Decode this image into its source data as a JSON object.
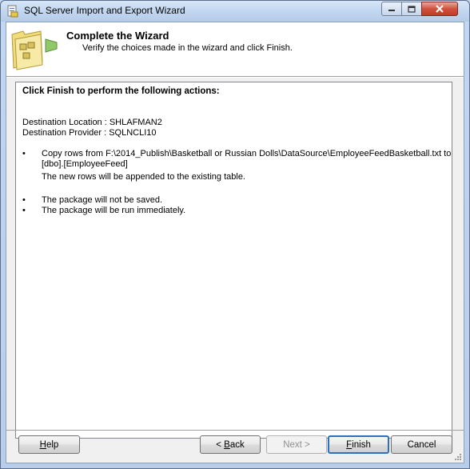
{
  "window": {
    "title": "SQL Server Import and Export Wizard"
  },
  "header": {
    "title": "Complete the Wizard",
    "subtitle": "Verify the choices made in the wizard and click Finish."
  },
  "content": {
    "heading": "Click Finish to perform the following actions:",
    "destination_location": "Destination Location : SHLAFMAN2",
    "destination_provider": "Destination Provider : SQLNCLI10",
    "actions": [
      {
        "line1": "Copy rows from F:\\2014_Publish\\Basketball or Russian Dolls\\DataSource\\EmployeeFeedBasketball.txt to",
        "line2": "[dbo].[EmployeeFeed]",
        "note": "The new rows will be appended to the existing table."
      },
      {
        "line1": "The package will not be saved."
      },
      {
        "line1": "The package will be run immediately."
      }
    ],
    "bullet_glyph": "•"
  },
  "buttons": {
    "help": {
      "mnemonic": "H",
      "rest": "elp"
    },
    "back": {
      "prefix": "< ",
      "mnemonic": "B",
      "rest": "ack"
    },
    "next": {
      "label": "Next >"
    },
    "finish": {
      "mnemonic": "F",
      "rest": "inish"
    },
    "cancel": {
      "label": "Cancel"
    }
  },
  "icons": {
    "app": "app-icon",
    "header": "wizard-folder-icon",
    "minimize": "minimize-icon",
    "maximize": "maximize-icon",
    "close": "close-icon"
  },
  "colors": {
    "title_bar": "#c2d7f0",
    "close_button": "#c03c28",
    "default_button_border": "#2f6fbf",
    "disabled_text": "#8f8f8f"
  }
}
